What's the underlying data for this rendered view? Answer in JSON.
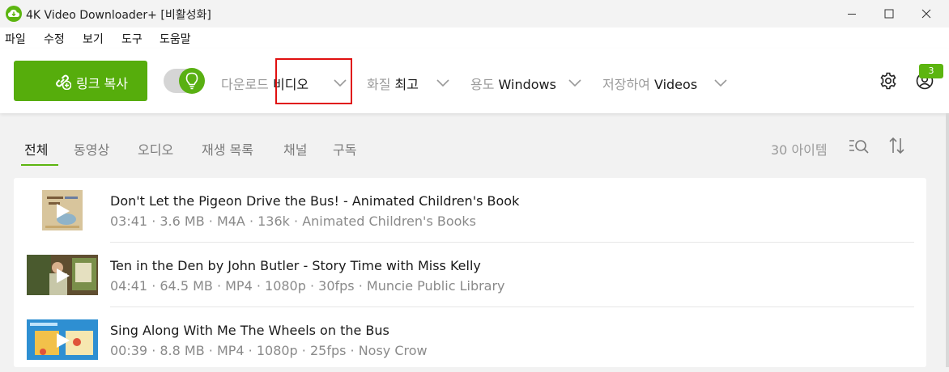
{
  "window": {
    "title": "4K Video Downloader+ [비활성화]"
  },
  "menu": [
    "파일",
    "수정",
    "보기",
    "도구",
    "도움말"
  ],
  "toolbar": {
    "copy_link_label": "링크 복사",
    "smart_mode_on": true,
    "download_label": "다운로드",
    "download_value": "비디오",
    "quality_label": "화질",
    "quality_value": "최고",
    "target_label": "용도",
    "target_value": "Windows",
    "save_to_label": "저장하여",
    "save_to_value": "Videos",
    "notification_count": "3",
    "accent_color": "#5cb510",
    "highlight_color": "#e01010"
  },
  "tabs": [
    "전체",
    "동영상",
    "오디오",
    "재생 목록",
    "채널",
    "구독"
  ],
  "active_tab": "전체",
  "item_count": "30 아이템",
  "items": [
    {
      "title": "Don't Let the Pigeon Drive the Bus! - Animated Children's Book",
      "meta": "03:41 · 3.6 MB · M4A · 136k · Animated Children's Books",
      "thumbnail_icon": "book-cover-thumbnail"
    },
    {
      "title": "Ten in the Den  by John Butler - Story Time with Miss Kelly",
      "meta": "04:41 · 64.5 MB · MP4 · 1080p · 30fps · Muncie Public Library",
      "thumbnail_icon": "storytime-video-thumbnail"
    },
    {
      "title": "Sing Along With Me The Wheels on the Bus",
      "meta": "00:39 · 8.8 MB · MP4 · 1080p · 25fps · Nosy Crow",
      "thumbnail_icon": "sing-along-video-thumbnail"
    }
  ]
}
